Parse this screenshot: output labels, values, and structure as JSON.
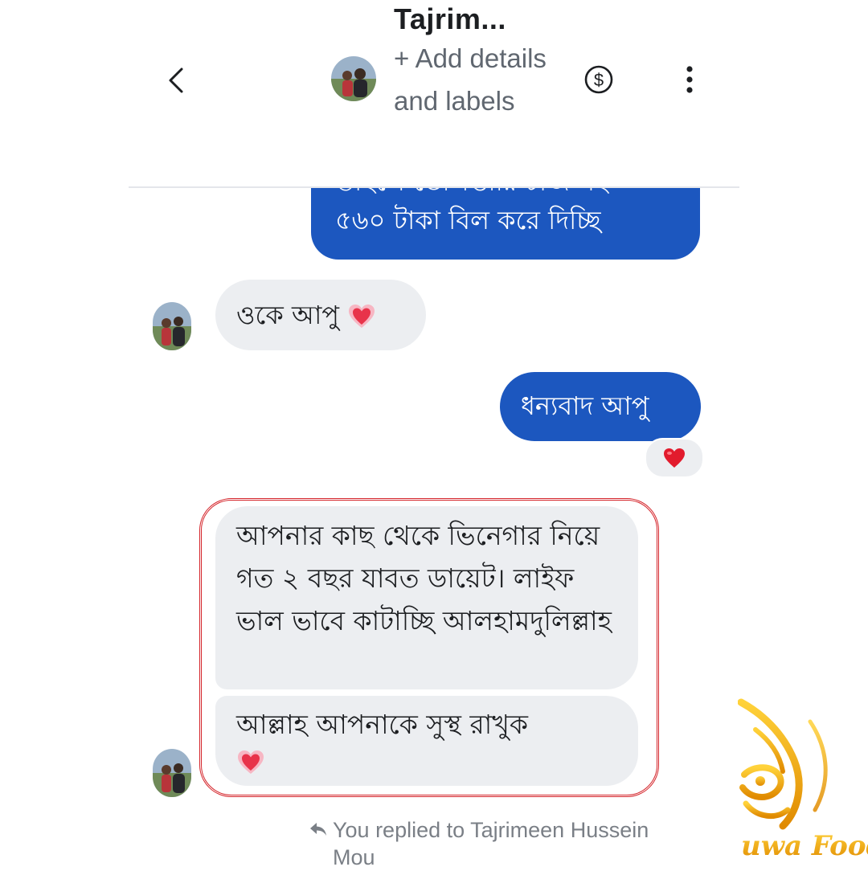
{
  "header": {
    "contact_name": "Tajrim...",
    "add_details": "+ Add details and labels",
    "back_icon": "chevron-left-icon",
    "payment_icon": "dollar-circle-icon",
    "menu_icon": "more-vertical-icon"
  },
  "messages": {
    "cut_line": "তাহলে ডেলিভারি চার্জ সহ",
    "sent_1": "৫৬০ টাকা  বিল করে দিচ্ছি",
    "recv_1": "ওকে আপু",
    "sent_2": "ধন্যবাদ আপু",
    "recv_2": "আপনার কাছ থেকে ভিনেগার নিয়ে গত ২ বছর যাবত ডায়েট। লাইফ ভাল ভাবে কাটাচ্ছি আলহামদুলিল্লাহ",
    "recv_3": "আল্লাহ আপনাকে সুস্থ রাখুক"
  },
  "reaction": {
    "icon": "red-heart-icon"
  },
  "footer": {
    "replied_text": "You replied to Tajrimeen Hussein Mou"
  },
  "watermark": {
    "brand_text": "uwa Foods"
  },
  "colors": {
    "sent_bubble": "#1c57bf",
    "received_bubble": "#eceef1",
    "highlight_border": "#d4242a",
    "watermark_gold": "#f0a500"
  }
}
